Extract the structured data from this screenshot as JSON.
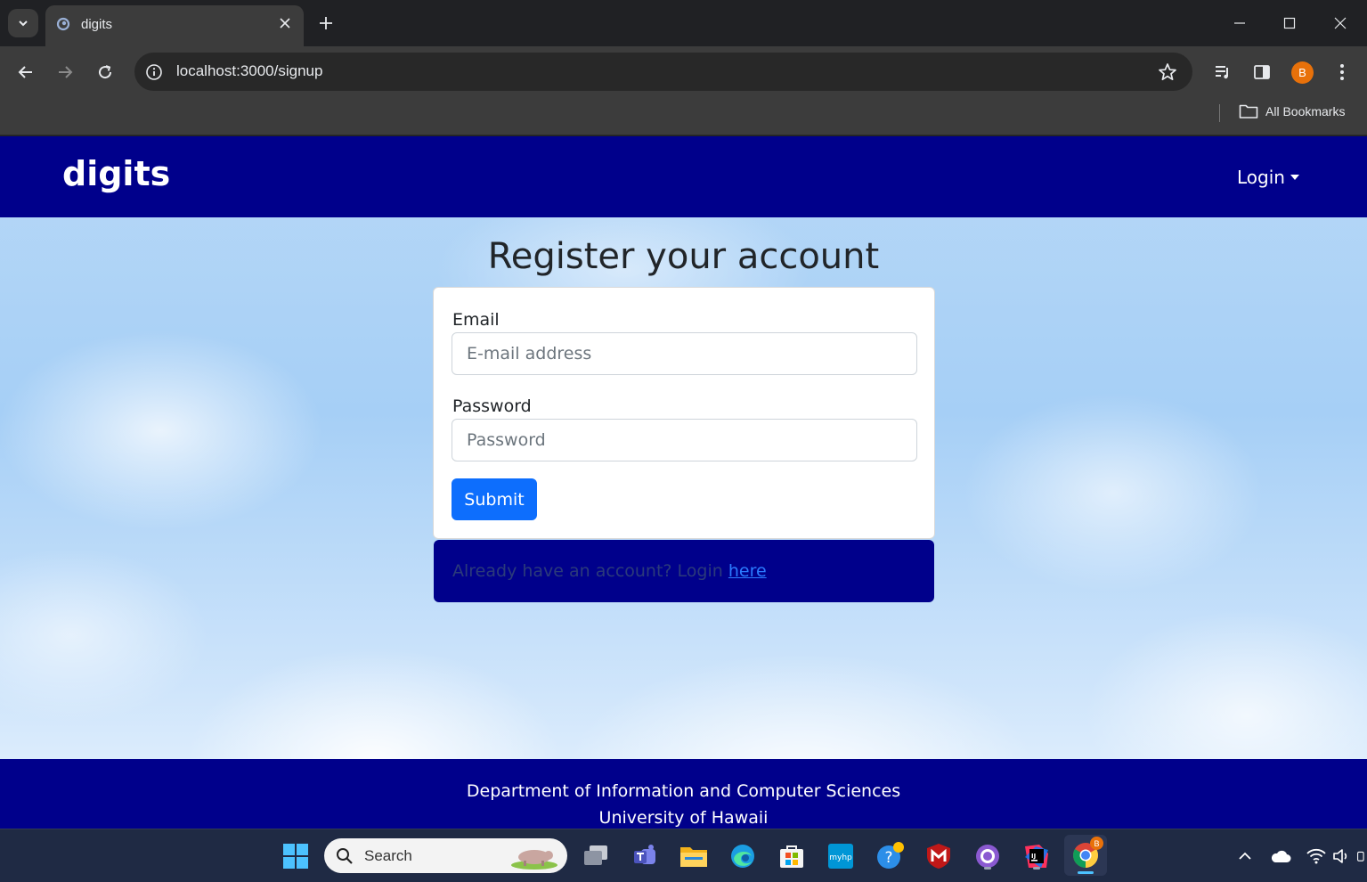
{
  "browser": {
    "tab": {
      "title": "digits"
    },
    "url": "localhost:3000/signup",
    "profile_initial": "B",
    "bookmarks_label": "All Bookmarks"
  },
  "site": {
    "brand": "digits",
    "login_menu": "Login",
    "heading": "Register your account",
    "form": {
      "email_label": "Email",
      "email_placeholder": "E-mail address",
      "password_label": "Password",
      "password_placeholder": "Password",
      "submit_label": "Submit"
    },
    "alert": {
      "text": "Already have an account? Login ",
      "link": "here"
    },
    "footer": {
      "line1": "Department of Information and Computer Sciences",
      "line2": "University of Hawaii"
    }
  },
  "taskbar": {
    "search_label": "Search",
    "chrome_badge": "B"
  },
  "colors": {
    "navbar": "#00008b",
    "primary_button": "#0d6efd",
    "link": "#2b7bff"
  }
}
